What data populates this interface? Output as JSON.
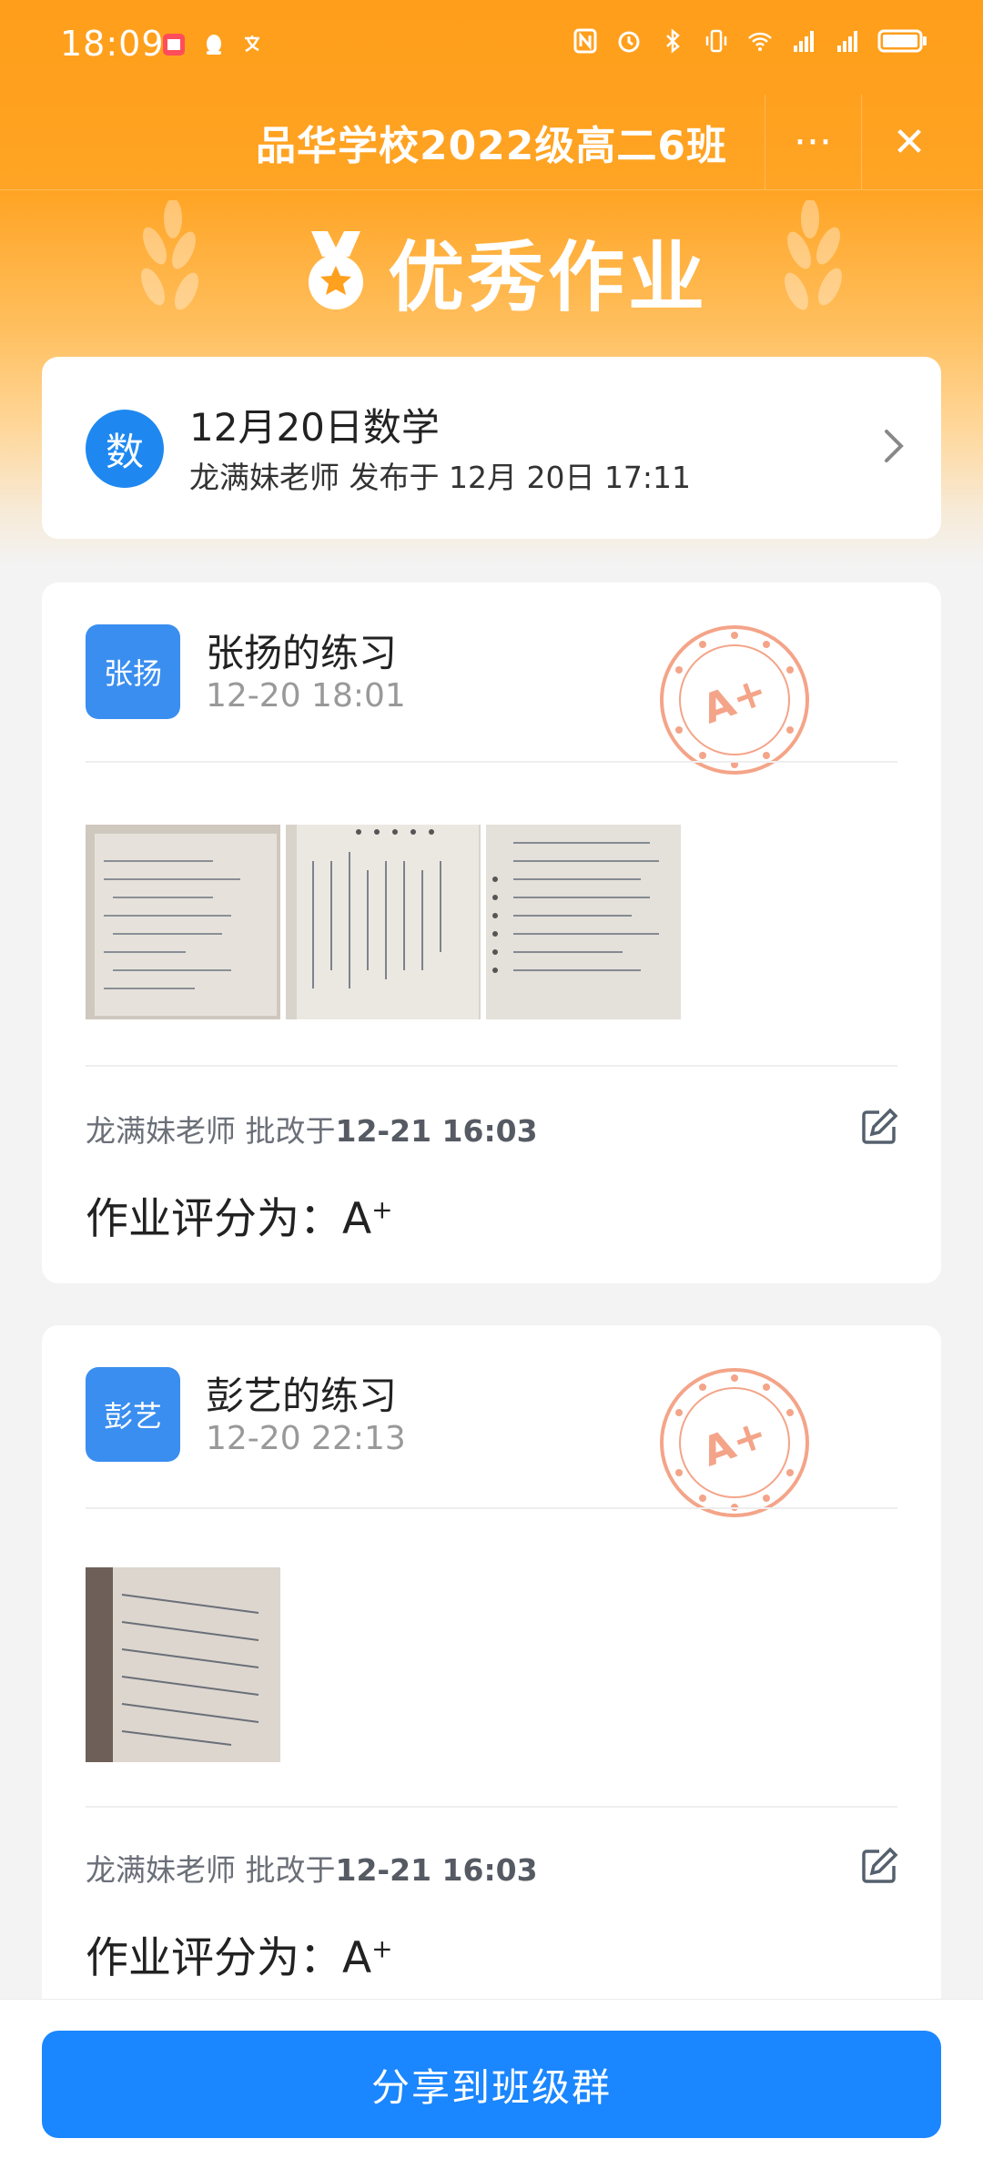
{
  "status": {
    "time": "18:09"
  },
  "header": {
    "title": "品华学校2022级高二6班",
    "more_label": "···",
    "close_label": "✕"
  },
  "banner": {
    "title": "优秀作业"
  },
  "homework": {
    "subject_badge": "数",
    "title": "12月20日数学",
    "meta": "龙满妹老师 发布于 12月 20日 17:11"
  },
  "submissions": [
    {
      "avatar": "张扬",
      "name": "张扬的练习",
      "time": "12-20 18:01",
      "stamp": "A+",
      "reviewer": "龙满妹老师 批改于",
      "reviewed_at": "12-21 16:03",
      "grade_label": "作业评分为：",
      "grade_letter": "A",
      "grade_plus": "+"
    },
    {
      "avatar": "彭艺",
      "name": "彭艺的练习",
      "time": "12-20 22:13",
      "stamp": "A+",
      "reviewer": "龙满妹老师 批改于",
      "reviewed_at": "12-21 16:03",
      "grade_label": "作业评分为：",
      "grade_letter": "A",
      "grade_plus": "+"
    }
  ],
  "footer": {
    "share_label": "分享到班级群"
  },
  "colors": {
    "header": "#ffa01f",
    "accent": "#1a86ff",
    "stamp": "#f4a488"
  },
  "icons": [
    "nfc-icon",
    "alarm-icon",
    "bluetooth-icon",
    "vibrate-icon",
    "wifi-icon",
    "signal-icon",
    "battery-icon",
    "medal-icon",
    "edit-icon",
    "chevron-right-icon"
  ]
}
